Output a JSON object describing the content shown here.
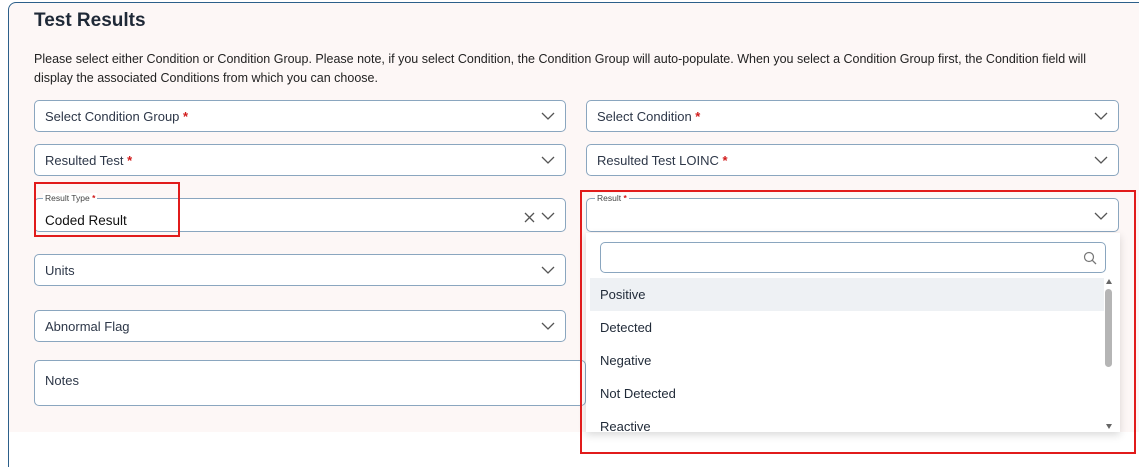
{
  "section": {
    "title": "Test Results",
    "instructions": "Please select either Condition or Condition Group. Please note, if you select Condition, the Condition Group will auto-populate. When you select a Condition Group first, the Condition field will display the associated Conditions from which you can choose."
  },
  "fields": {
    "condition_group": {
      "label": "Select Condition Group",
      "required": "*"
    },
    "condition": {
      "label": "Select Condition",
      "required": "*"
    },
    "resulted_test": {
      "label": "Resulted Test",
      "required": "*"
    },
    "resulted_test_loinc": {
      "label": "Resulted Test LOINC",
      "required": "*"
    },
    "result_type": {
      "label": "Result Type",
      "required": "*",
      "value": "Coded Result"
    },
    "result": {
      "label": "Result",
      "required": "*"
    },
    "units": {
      "label": "Units"
    },
    "abnormal_flag": {
      "label": "Abnormal Flag"
    },
    "notes": {
      "label": "Notes"
    }
  },
  "result_dropdown": {
    "search_value": "",
    "options": [
      "Positive",
      "Detected",
      "Negative",
      "Not Detected",
      "Reactive"
    ],
    "highlighted": "Positive"
  },
  "colors": {
    "panel_border": "#2c5f8a",
    "panel_background": "#fdf7f6",
    "required_mark": "#d11a1a",
    "annotation_box": "#e11b1b"
  },
  "icons": [
    "chevron-down-icon",
    "close-icon",
    "search-icon"
  ]
}
